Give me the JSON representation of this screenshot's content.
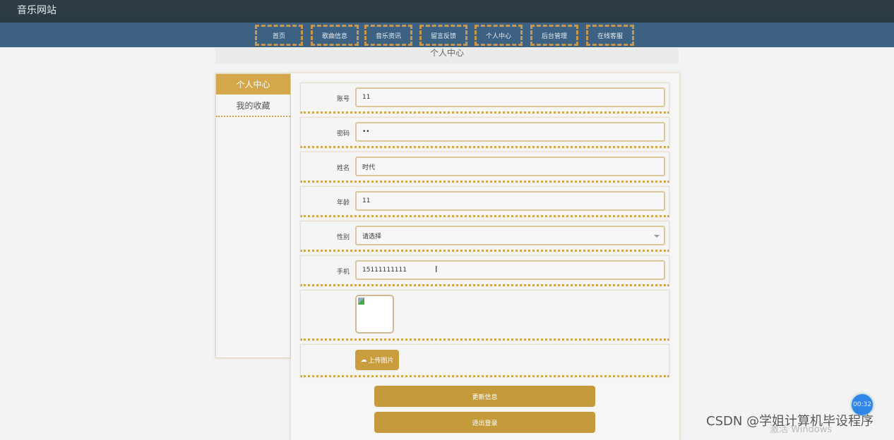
{
  "header": {
    "site_title": "音乐网站"
  },
  "nav": [
    "首页",
    "歌曲信息",
    "音乐资讯",
    "留言反馈",
    "个人中心",
    "后台管理",
    "在线客服"
  ],
  "page_title": "个人中心",
  "sidebar": {
    "items": [
      {
        "label": "个人中心",
        "active": true
      },
      {
        "label": "我的收藏",
        "active": false
      }
    ]
  },
  "form": {
    "fields": [
      {
        "label": "账号",
        "value": "11"
      },
      {
        "label": "密码",
        "value": "••"
      },
      {
        "label": "姓名",
        "value": "时代"
      },
      {
        "label": "年龄",
        "value": "11"
      },
      {
        "label": "性别",
        "value": "请选择"
      },
      {
        "label": "手机",
        "value": "15111111111"
      }
    ],
    "upload_label": "上传图片",
    "update_label": "更新信息",
    "logout_label": "退出登录"
  },
  "overlay": {
    "timer": "00:32",
    "watermark": "CSDN @学姐计算机毕设程序",
    "activate": "激活 Windows"
  },
  "colors": {
    "accent": "#c99c3e",
    "nav_bg": "#3d6183",
    "top_bg": "#2c3a44"
  }
}
